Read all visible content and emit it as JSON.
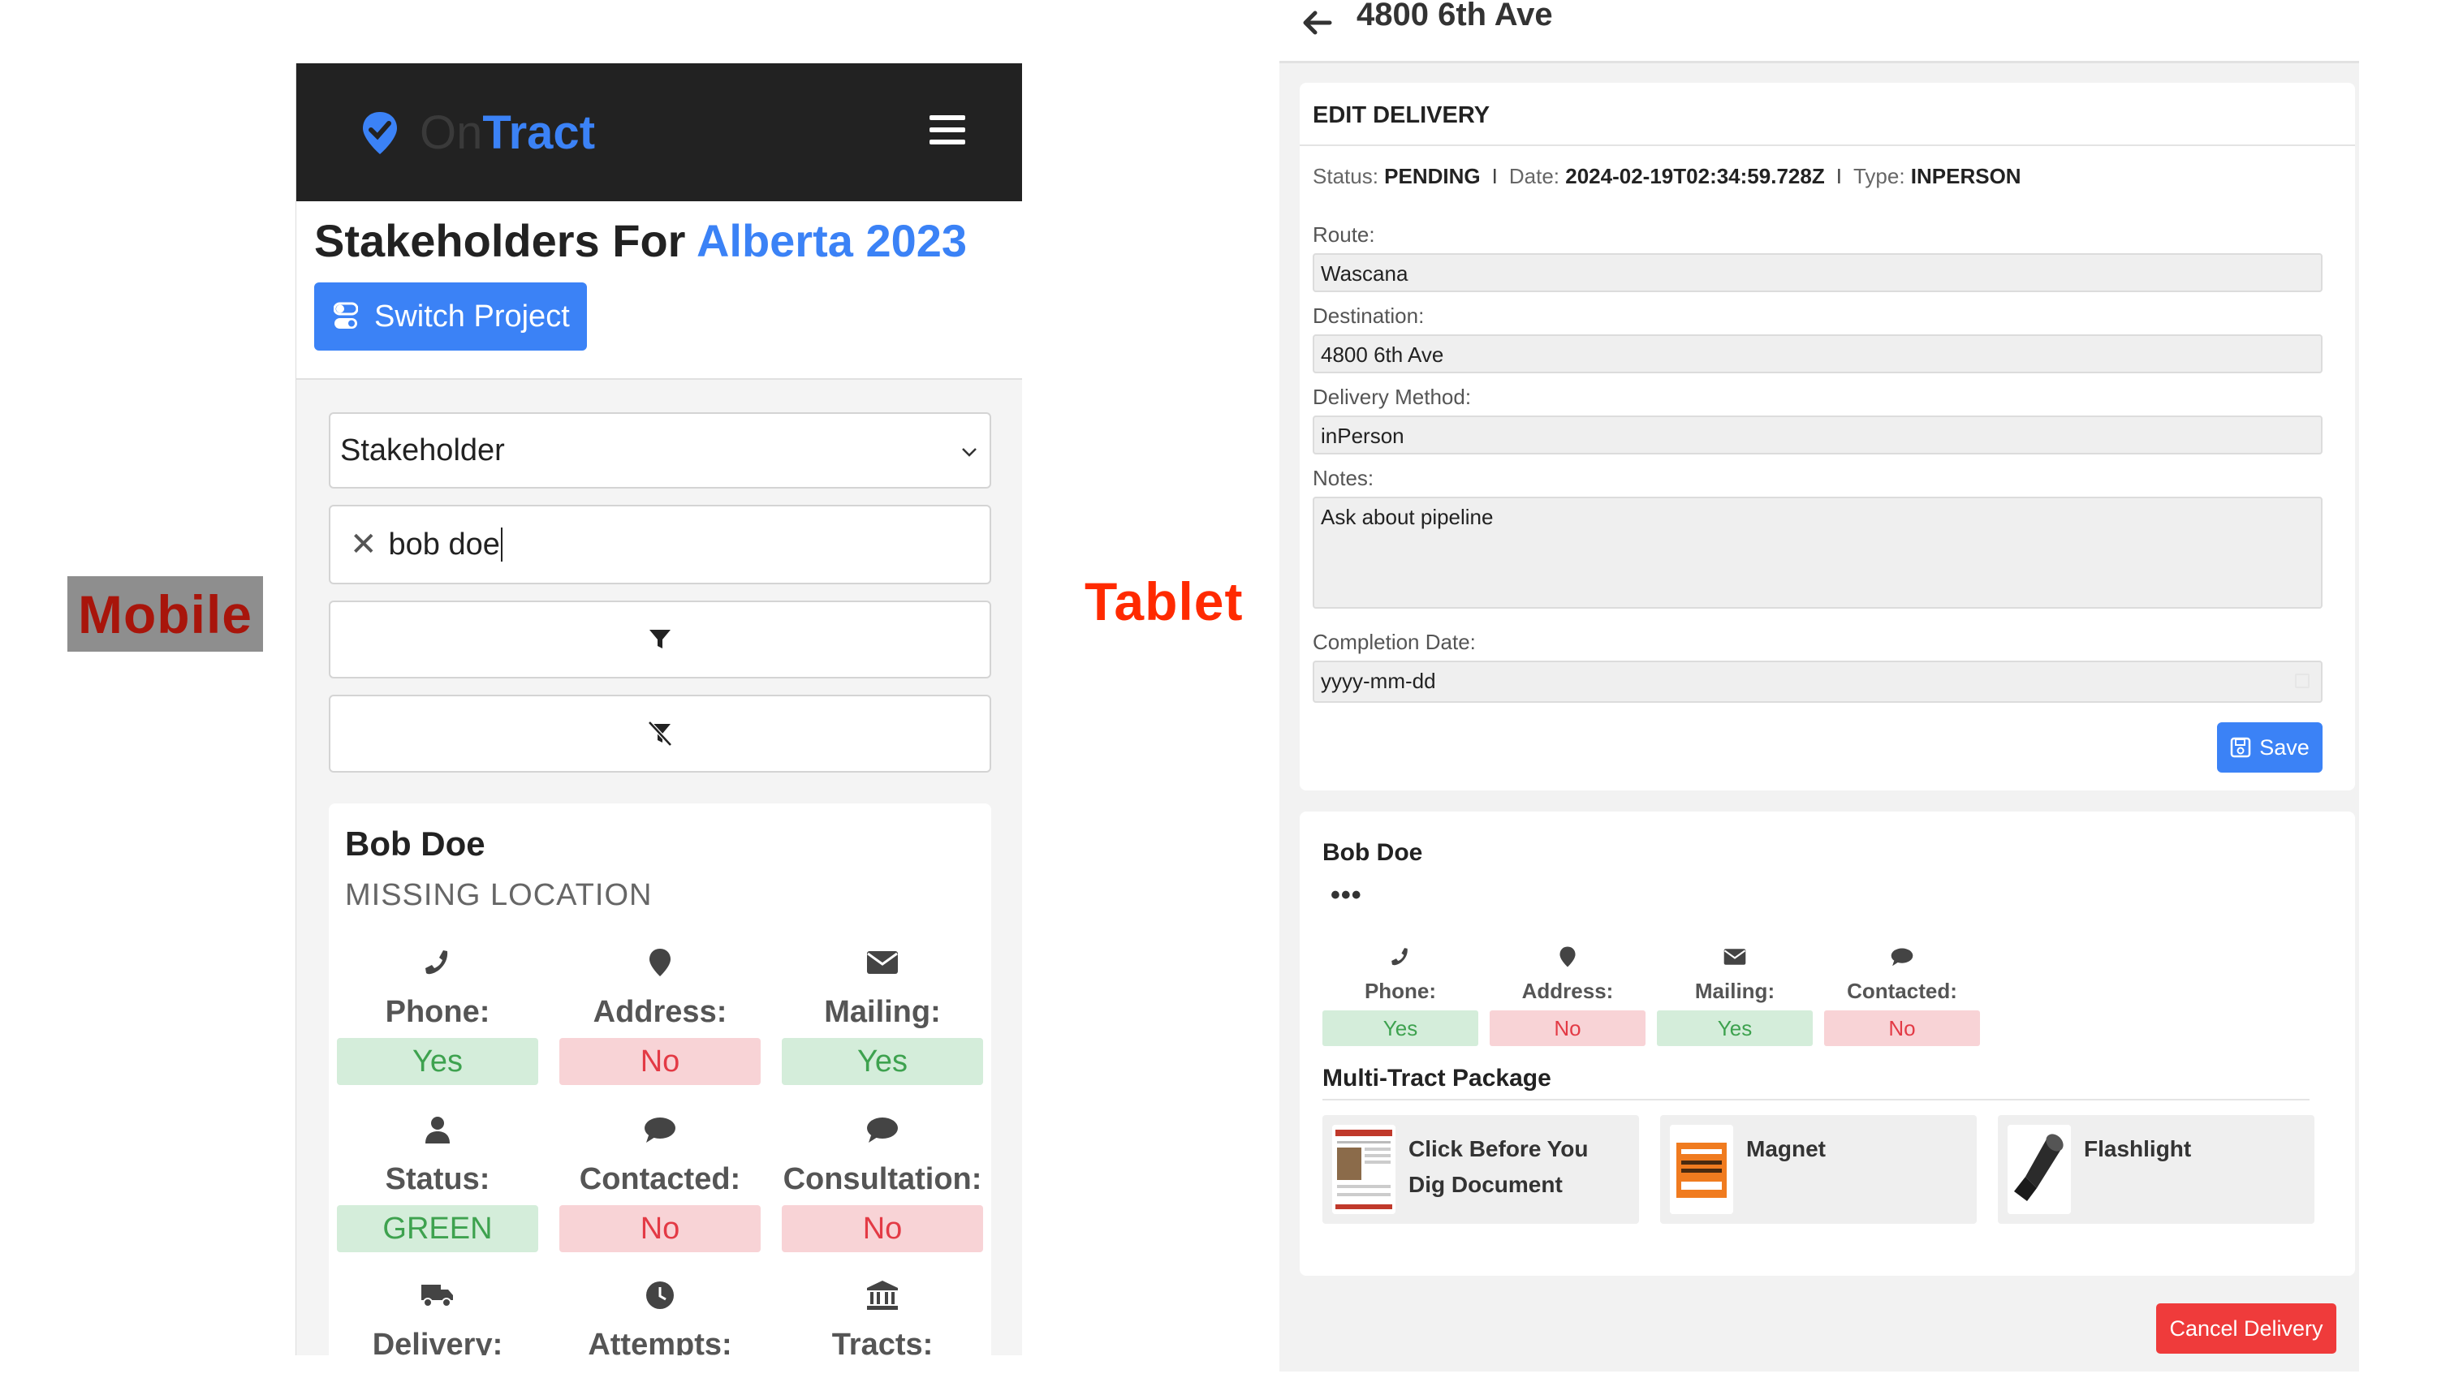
{
  "labels": {
    "mobile": "Mobile",
    "tablet": "Tablet"
  },
  "colors": {
    "brand_blue": "#3b82f6",
    "success_bg": "#d4edda",
    "danger_bg": "#f8d3d6",
    "danger_button": "#ef3b3b",
    "nav_dark": "#222222"
  },
  "mobile": {
    "brand": {
      "on": "On",
      "tract": "Tract"
    },
    "menu_icon": "hamburger-icon",
    "title_prefix": "Stakeholders For ",
    "project": "Alberta 2023",
    "switch_project": "Switch Project",
    "select_value": "Stakeholder",
    "search_value": "bob doe",
    "filter_icon": "filter-icon",
    "clear_filter_icon": "filter-off-icon",
    "card": {
      "name": "Bob Doe",
      "subtitle": "MISSING LOCATION",
      "fields": [
        {
          "label": "Phone:",
          "value": "Yes",
          "icon": "phone-icon"
        },
        {
          "label": "Address:",
          "value": "No",
          "icon": "map-marker-icon"
        },
        {
          "label": "Mailing:",
          "value": "Yes",
          "icon": "envelope-icon"
        },
        {
          "label": "Status:",
          "value": "GREEN",
          "icon": "user-icon"
        },
        {
          "label": "Contacted:",
          "value": "No",
          "icon": "comment-icon"
        },
        {
          "label": "Consultation:",
          "value": "No",
          "icon": "comment-icon"
        },
        {
          "label": "Delivery:",
          "icon": "truck-icon"
        },
        {
          "label": "Attempts:",
          "icon": "clock-icon"
        },
        {
          "label": "Tracts:",
          "icon": "bank-icon"
        }
      ]
    }
  },
  "tablet": {
    "top_title": "4800 6th Ave",
    "edit_title": "EDIT DELIVERY",
    "status": {
      "status_label": "Status:",
      "status_value": "PENDING",
      "date_label": "Date:",
      "date_value": "2024-02-19T02:34:59.728Z",
      "type_label": "Type:",
      "type_value": "INPERSON",
      "separator": "I"
    },
    "form": {
      "route_label": "Route:",
      "route_value": "Wascana",
      "destination_label": "Destination:",
      "destination_value": "4800 6th Ave",
      "method_label": "Delivery Method:",
      "method_value": "inPerson",
      "notes_label": "Notes:",
      "notes_value": "Ask about pipeline",
      "completion_label": "Completion Date:",
      "completion_placeholder": "yyyy-mm-dd"
    },
    "save": "Save",
    "person": {
      "name": "Bob Doe",
      "more": "•••",
      "fields": [
        {
          "label": "Phone:",
          "value": "Yes",
          "icon": "phone-icon"
        },
        {
          "label": "Address:",
          "value": "No",
          "icon": "map-marker-icon"
        },
        {
          "label": "Mailing:",
          "value": "Yes",
          "icon": "envelope-icon"
        },
        {
          "label": "Contacted:",
          "value": "No",
          "icon": "comment-icon"
        }
      ]
    },
    "multi_title": "Multi-Tract Package",
    "package": [
      {
        "name": "Click Before You Dig Document"
      },
      {
        "name": "Magnet"
      },
      {
        "name": "Flashlight"
      }
    ],
    "cancel": "Cancel Delivery"
  }
}
